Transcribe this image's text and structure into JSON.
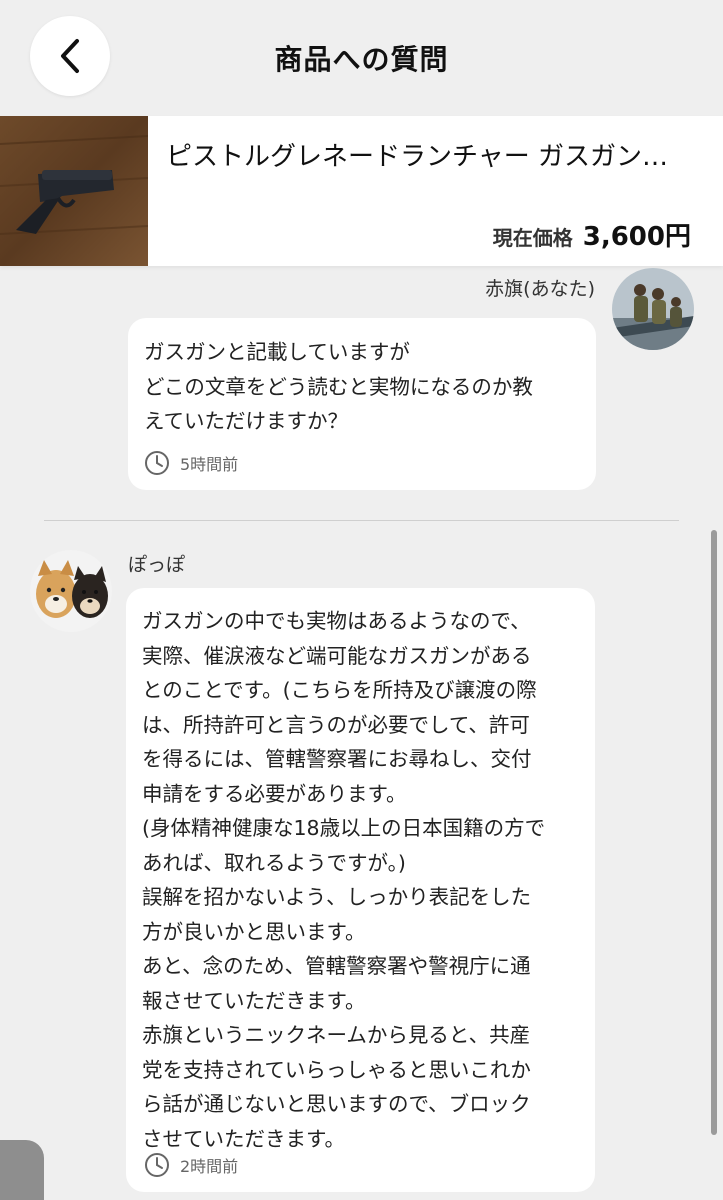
{
  "header": {
    "title": "商品への質問",
    "back_icon": "chevron-left-icon"
  },
  "product": {
    "name": "ピストルグレネードランチャー ガスガン…",
    "price_label": "現在価格",
    "price_value": "3,600円"
  },
  "messages": [
    {
      "user": "赤旗(あなた)",
      "lines": [
        "ガスガンと記載していますが",
        "どこの文章をどう読むと実物になるのか教",
        "えていただけますか？"
      ],
      "time": "5時間前"
    },
    {
      "user": "ぽっぽ",
      "lines": [
        "ガスガンの中でも実物はあるようなので、",
        "実際、催涙液など端可能なガスガンがある",
        "とのことです。(こちらを所持及び譲渡の際",
        "は、所持許可と言うのが必要でして、許可",
        "を得るには、管轄警察署にお尋ねし、交付",
        "申請をする必要があります。",
        "(身体精神健康な18歳以上の日本国籍の方で",
        "あれば、取れるようですが。)",
        "誤解を招かないよう、しっかり表記をした",
        "方が良いかと思います。",
        "あと、念のため、管轄警察署や警視庁に通",
        "報させていただきます。",
        "赤旗というニックネームから見ると、共産",
        "党を支持されていらっしゃると思いこれか",
        "ら話が通じないと思いますので、ブロック",
        "させていただきます。"
      ],
      "time": "2時間前"
    }
  ]
}
